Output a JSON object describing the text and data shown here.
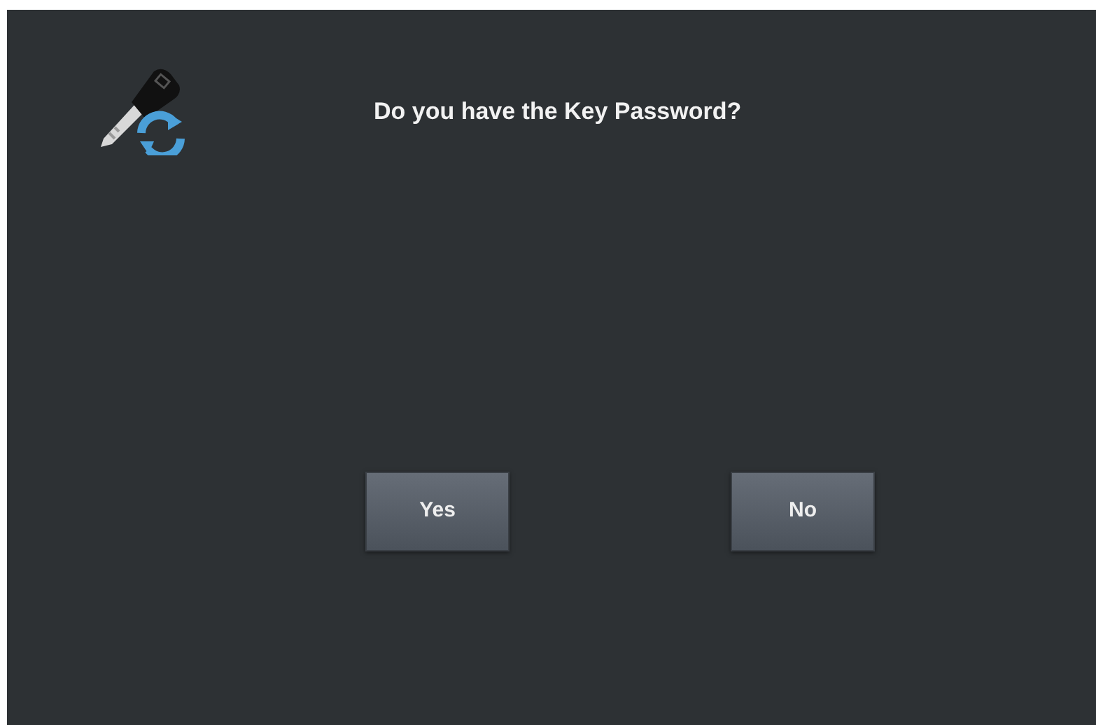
{
  "dialog": {
    "question": "Do you have the Key Password?"
  },
  "buttons": [
    {
      "label": "Yes"
    },
    {
      "label": "No"
    }
  ]
}
